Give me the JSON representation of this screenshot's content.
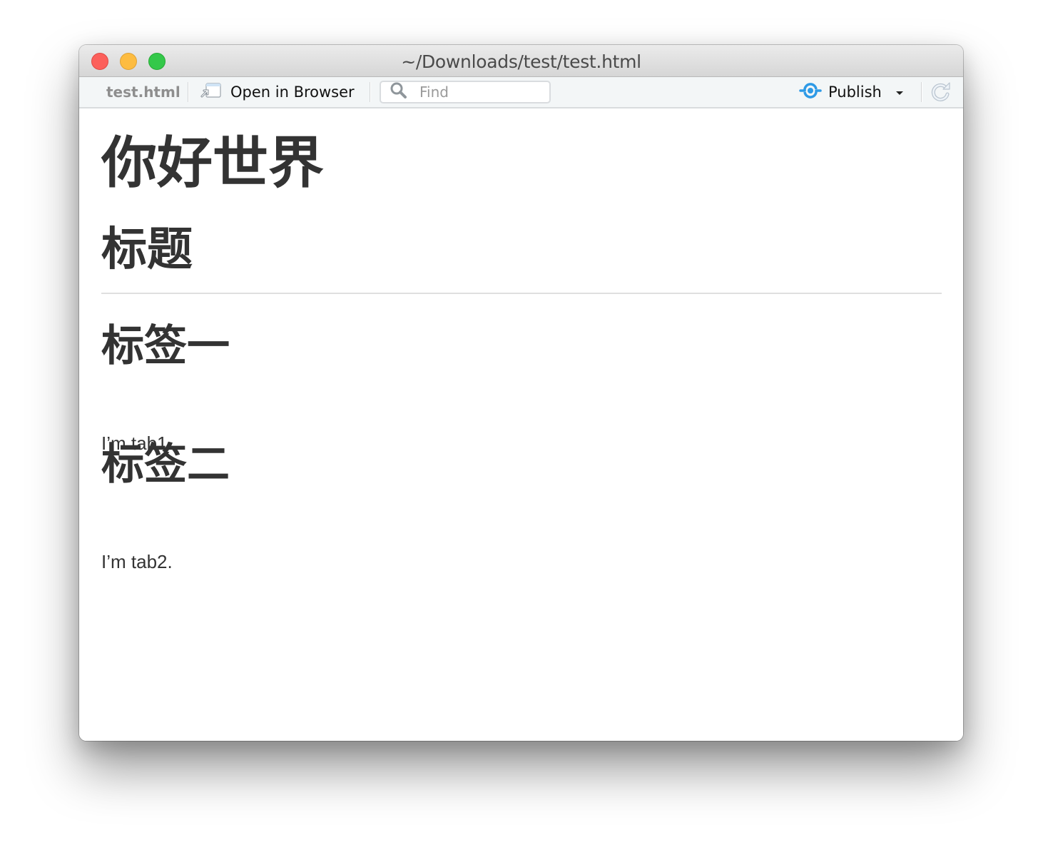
{
  "window": {
    "title": "~/Downloads/test/test.html",
    "traffic_lights": [
      "close",
      "minimize",
      "maximize"
    ]
  },
  "toolbar": {
    "file_name": "test.html",
    "open_in_browser": {
      "label": "Open in Browser",
      "icon": "open-in-browser-icon"
    },
    "find": {
      "placeholder": "Find",
      "value": "",
      "icon": "search-icon"
    },
    "publish": {
      "label": "Publish",
      "icon": "publish-icon",
      "dropdown_icon": "caret-down-icon",
      "accent": "#2e9ae6"
    },
    "refresh": {
      "icon": "refresh-icon"
    }
  },
  "document": {
    "h1": "你好世界",
    "h2": "标题",
    "sections": [
      {
        "heading": "标签一",
        "text": "I’m tab1."
      },
      {
        "heading": "标签二",
        "text": "I’m tab2."
      }
    ]
  }
}
